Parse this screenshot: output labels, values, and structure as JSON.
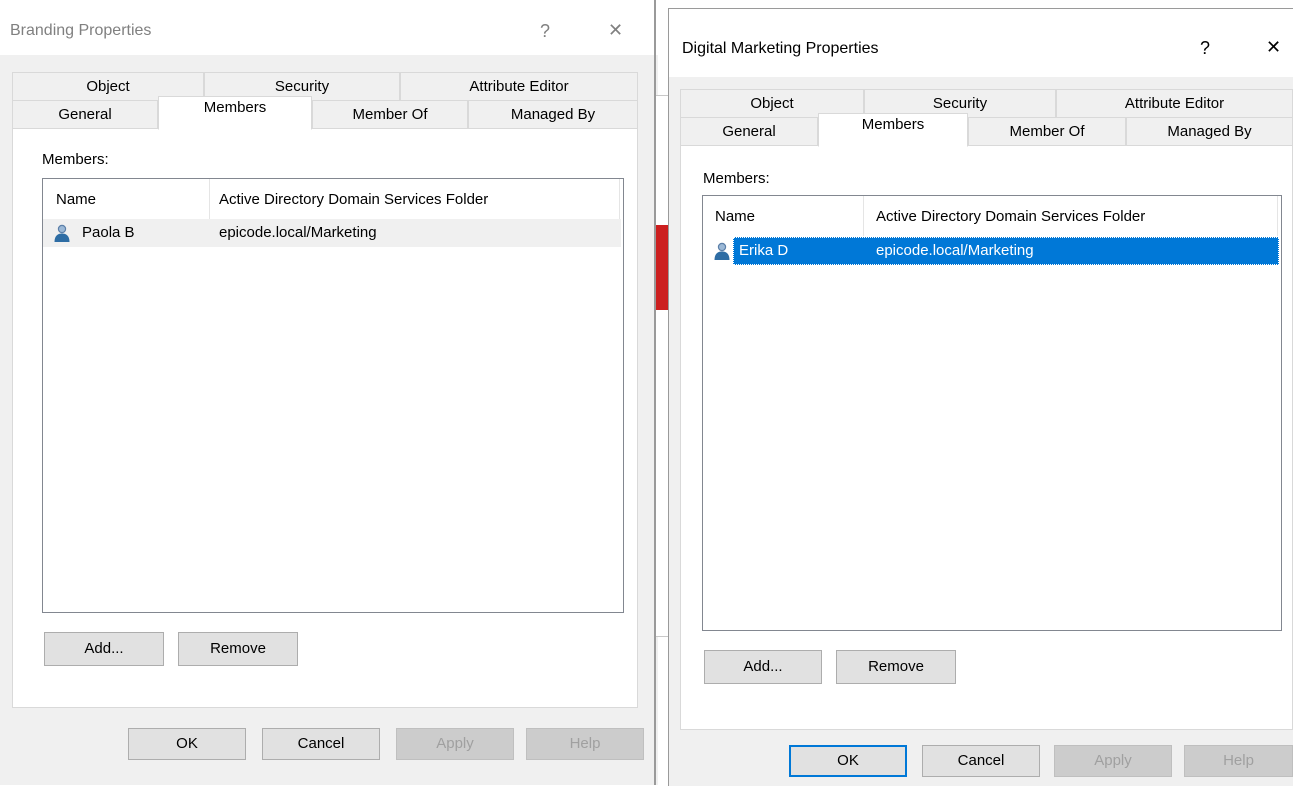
{
  "left_dialog": {
    "title": "Branding Properties",
    "help_glyph": "?",
    "close_glyph": "✕",
    "tabs_row1": [
      "Object",
      "Security",
      "Attribute Editor"
    ],
    "tabs_row2": [
      "General",
      "Members",
      "Member Of",
      "Managed By"
    ],
    "active_tab": "Members",
    "members_label": "Members:",
    "columns": [
      "Name",
      "Active Directory Domain Services Folder"
    ],
    "rows": [
      {
        "name": "Paola B",
        "folder": "epicode.local/Marketing",
        "icon": "user-icon"
      }
    ],
    "add_label": "Add...",
    "remove_label": "Remove",
    "ok_label": "OK",
    "cancel_label": "Cancel",
    "apply_label": "Apply",
    "help_label": "Help"
  },
  "right_dialog": {
    "title": "Digital Marketing Properties",
    "help_glyph": "?",
    "close_glyph": "✕",
    "tabs_row1": [
      "Object",
      "Security",
      "Attribute Editor"
    ],
    "tabs_row2": [
      "General",
      "Members",
      "Member Of",
      "Managed By"
    ],
    "active_tab": "Members",
    "members_label": "Members:",
    "columns": [
      "Name",
      "Active Directory Domain Services Folder"
    ],
    "rows": [
      {
        "name": "Erika D",
        "folder": "epicode.local/Marketing",
        "icon": "user-icon",
        "selected": true
      }
    ],
    "add_label": "Add...",
    "remove_label": "Remove",
    "ok_label": "OK",
    "cancel_label": "Cancel",
    "apply_label": "Apply",
    "help_label": "Help"
  },
  "colors": {
    "selection": "#0078d7",
    "background_fragment": "#cc1f1f"
  }
}
